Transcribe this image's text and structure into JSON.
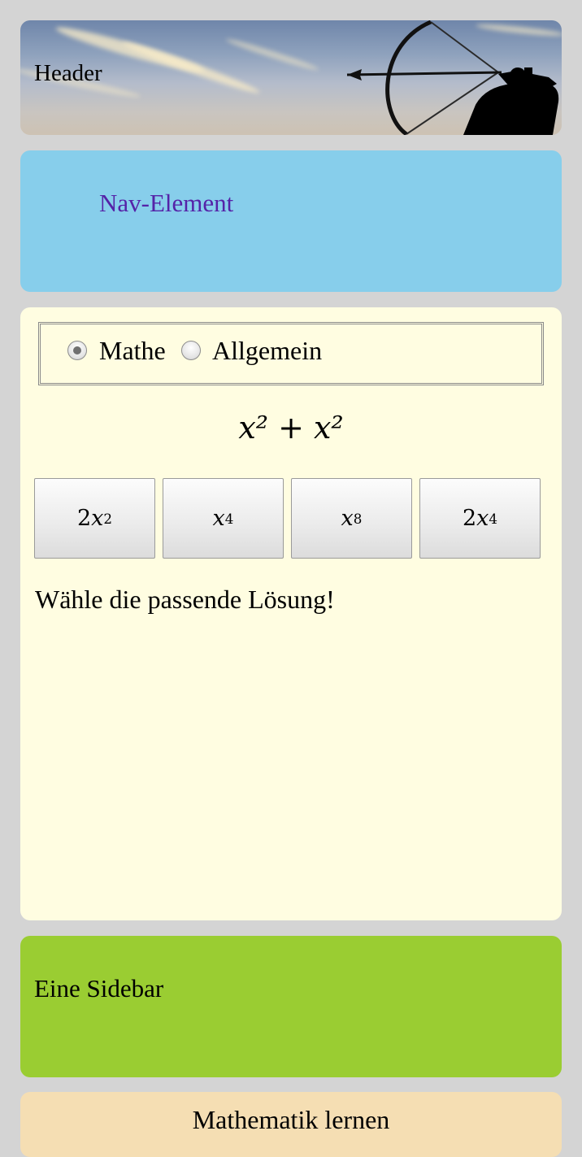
{
  "header": {
    "title": "Header",
    "image_icon": "archer-icon"
  },
  "nav": {
    "link_label": "Nav-Element"
  },
  "main": {
    "mode": {
      "options": [
        {
          "label": "Mathe",
          "checked": true
        },
        {
          "label": "Allgemein",
          "checked": false
        }
      ]
    },
    "formula": "x² + x²",
    "answers": [
      {
        "coef": "2",
        "var": "x",
        "exp": "2"
      },
      {
        "coef": "",
        "var": "x",
        "exp": "4"
      },
      {
        "coef": "",
        "var": "x",
        "exp": "8"
      },
      {
        "coef": "2",
        "var": "x",
        "exp": "4"
      }
    ],
    "instruction": "Wähle die passende Lösung!"
  },
  "sidebar": {
    "text": "Eine Sidebar"
  },
  "footer": {
    "text": "Mathematik lernen"
  },
  "colors": {
    "page_background": "#d4d4d4",
    "nav_background": "#87ceeb",
    "nav_link": "#5523a8",
    "main_background": "#fffde1",
    "sidebar_background": "#9acd32",
    "footer_background": "#f5deb3"
  }
}
